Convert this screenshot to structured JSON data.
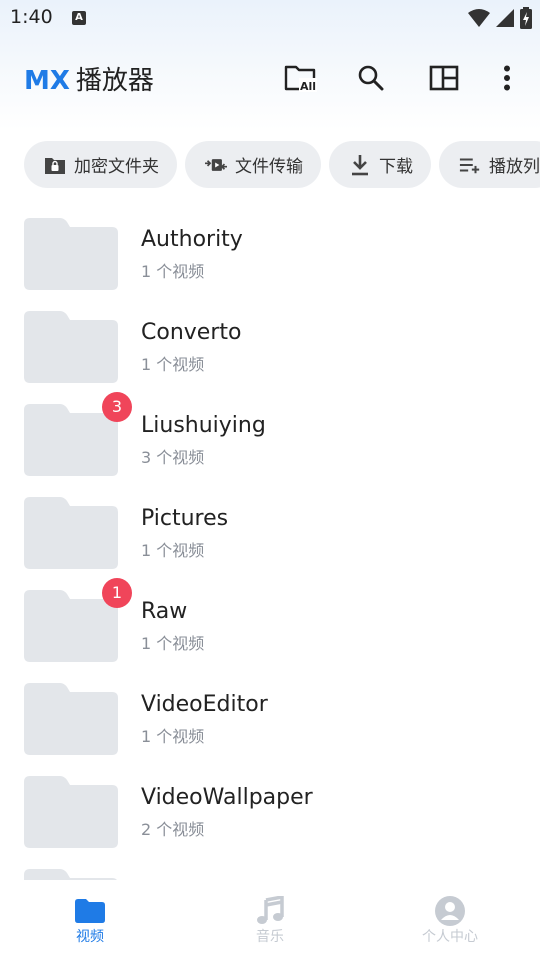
{
  "status": {
    "time": "1:40",
    "notification_letter": "A"
  },
  "app": {
    "brand_mx": "MX",
    "brand_name": "播放器"
  },
  "appbar_icons": [
    "folder-all-icon",
    "search-icon",
    "view-layout-icon",
    "more-vertical-icon"
  ],
  "folder_all_label": "All",
  "chips": [
    {
      "label": "加密文件夹",
      "icon": "lock-folder-icon"
    },
    {
      "label": "文件传输",
      "icon": "file-transfer-icon"
    },
    {
      "label": "下载",
      "icon": "download-icon"
    },
    {
      "label": "播放列",
      "icon": "playlist-add-icon"
    }
  ],
  "folders": [
    {
      "name": "Authority",
      "count": "1 个视频",
      "badge": ""
    },
    {
      "name": "Converto",
      "count": "1 个视频",
      "badge": ""
    },
    {
      "name": "Liushuiying",
      "count": "3 个视频",
      "badge": "3"
    },
    {
      "name": "Pictures",
      "count": "1 个视频",
      "badge": ""
    },
    {
      "name": "Raw",
      "count": "1 个视频",
      "badge": "1"
    },
    {
      "name": "VideoEditor",
      "count": "1 个视频",
      "badge": ""
    },
    {
      "name": "VideoWallpaper",
      "count": "2 个视频",
      "badge": ""
    },
    {
      "name": "",
      "count": "",
      "badge": ""
    }
  ],
  "bottom_nav": [
    {
      "label": "视频",
      "icon": "video-folder-icon",
      "active": true
    },
    {
      "label": "音乐",
      "icon": "music-note-icon",
      "active": false
    },
    {
      "label": "个人中心",
      "icon": "account-icon",
      "active": false
    }
  ],
  "colors": {
    "accent": "#1f7be6",
    "badge": "#f0455a",
    "folder": "#e3e6ea",
    "chip_bg": "#eceef1"
  }
}
